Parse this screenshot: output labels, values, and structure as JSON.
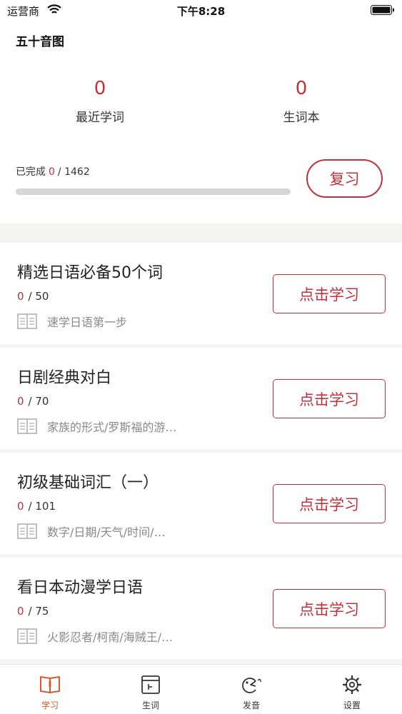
{
  "status_bar": {
    "carrier": "运营商",
    "time": "下午8:28"
  },
  "header": {
    "title": "五十音图"
  },
  "stats": {
    "recent": {
      "count": "0",
      "label": "最近学词"
    },
    "vocab_book": {
      "count": "0",
      "label": "生词本"
    }
  },
  "progress": {
    "label": "已完成",
    "completed": "0",
    "separator": "/",
    "total": "1462",
    "fraction": 0
  },
  "review_button": "复习",
  "courses": [
    {
      "title": "精选日语必备50个词",
      "completed": "0",
      "total": "/ 50",
      "description": "速学日语第一步",
      "button": "点击学习"
    },
    {
      "title": "日剧经典对白",
      "completed": "0",
      "total": "/ 70",
      "description": "家族的形式/罗斯福的游…",
      "button": "点击学习"
    },
    {
      "title": "初级基础词汇（一）",
      "completed": "0",
      "total": "/ 101",
      "description": "数字/日期/天气/时间/…",
      "button": "点击学习"
    },
    {
      "title": "看日本动漫学日语",
      "completed": "0",
      "total": "/ 75",
      "description": "火影忍者/柯南/海贼王/…",
      "button": "点击学习"
    }
  ],
  "tabs": [
    {
      "label": "学习",
      "icon": "study-book-icon",
      "active": true
    },
    {
      "label": "生词",
      "icon": "vocab-card-icon",
      "active": false
    },
    {
      "label": "发音",
      "icon": "pronunciation-icon",
      "active": false
    },
    {
      "label": "设置",
      "icon": "settings-gear-icon",
      "active": false
    }
  ],
  "colors": {
    "accent": "#c0313a",
    "active_tab": "#d65a2e",
    "muted_text": "#888888"
  }
}
